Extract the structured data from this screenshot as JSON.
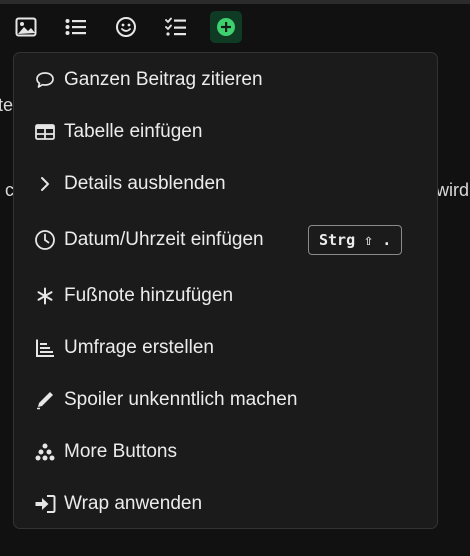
{
  "toolbar": {
    "buttons": [
      {
        "icon": "image-icon"
      },
      {
        "icon": "bullet-list-icon"
      },
      {
        "icon": "emoji-icon"
      },
      {
        "icon": "checklist-icon"
      },
      {
        "icon": "plus-circle-icon",
        "active": true
      }
    ],
    "accent_color": "#3ecf6e"
  },
  "background_fragments": {
    "left_top": "te",
    "left_mid": "c",
    "right_mid": "wird"
  },
  "menu": {
    "items": [
      {
        "label": "Ganzen Beitrag zitieren",
        "icon": "speech-bubble-icon"
      },
      {
        "label": "Tabelle einfügen",
        "icon": "table-icon"
      },
      {
        "label": "Details ausblenden",
        "icon": "chevron-right-icon"
      },
      {
        "label": "Datum/Uhrzeit einfügen",
        "icon": "clock-icon",
        "shortcut": "Strg ⇧ ."
      },
      {
        "label": "Fußnote hinzufügen",
        "icon": "asterisk-icon"
      },
      {
        "label": "Umfrage erstellen",
        "icon": "poll-chart-icon"
      },
      {
        "label": "Spoiler unkenntlich machen",
        "icon": "marker-pen-icon"
      },
      {
        "label": "More Buttons",
        "icon": "more-dots-icon"
      },
      {
        "label": "Wrap anwenden",
        "icon": "sign-in-icon"
      }
    ]
  }
}
